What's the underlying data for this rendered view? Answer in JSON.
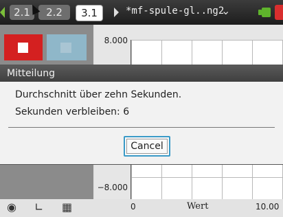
{
  "tabs": [
    {
      "label": "2.1"
    },
    {
      "label": "2.2"
    },
    {
      "label": "3.1"
    }
  ],
  "document": {
    "title": "*mf-spule-gl..ng2"
  },
  "sensor_buttons": {
    "stop": "stop",
    "start": "start"
  },
  "graph": {
    "y_max": "8.000",
    "y_min": "−8.000",
    "x_min": "0",
    "x_max": "10.00",
    "x_axis_name": "Wert"
  },
  "dialog": {
    "title": "Mitteilung",
    "message": "Durchschnitt über zehn Sekunden.",
    "countdown": "Sekunden verbleiben: 6",
    "cancel_label": "Cancel"
  },
  "toolbar": {
    "tools": [
      "sensor-icon",
      "graph-icon",
      "table-icon"
    ]
  },
  "colors": {
    "stop": "#d42020",
    "accent": "#3a9ac7",
    "battery": "#5fb42c"
  }
}
